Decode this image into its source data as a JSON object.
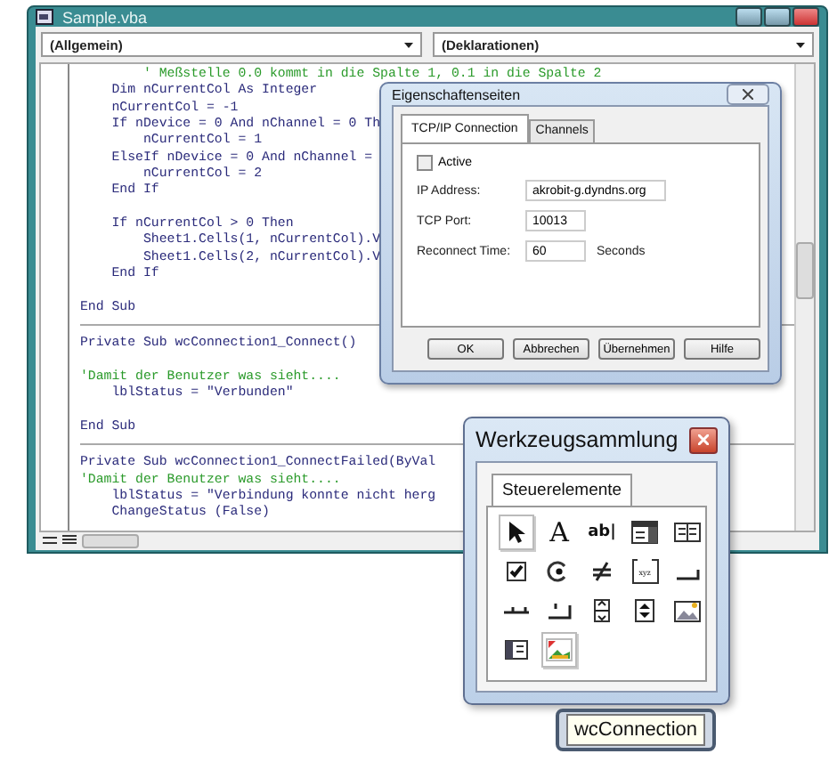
{
  "editor": {
    "title": "Sample.vba",
    "object_dropdown": "(Allgemein)",
    "procedure_dropdown": "(Deklarationen)",
    "procedures": [
      {
        "lines": [
          {
            "kind": "comment",
            "text": "        ' Meßstelle 0.0 kommt in die Spalte 1, 0.1 in die Spalte 2"
          },
          {
            "kind": "code",
            "text": "    Dim nCurrentCol As Integer"
          },
          {
            "kind": "code",
            "text": "    nCurrentCol = -1"
          },
          {
            "kind": "code",
            "text": "    If nDevice = 0 And nChannel = 0 Th"
          },
          {
            "kind": "code",
            "text": "        nCurrentCol = 1"
          },
          {
            "kind": "code",
            "text": "    ElseIf nDevice = 0 And nChannel ="
          },
          {
            "kind": "code",
            "text": "        nCurrentCol = 2"
          },
          {
            "kind": "code",
            "text": "    End If"
          },
          {
            "kind": "blank"
          },
          {
            "kind": "code",
            "text": "    If nCurrentCol > 0 Then"
          },
          {
            "kind": "code",
            "text": "        Sheet1.Cells(1, nCurrentCol).V"
          },
          {
            "kind": "code",
            "text": "        Sheet1.Cells(2, nCurrentCol).V"
          },
          {
            "kind": "code",
            "text": "    End If"
          },
          {
            "kind": "blank"
          },
          {
            "kind": "code",
            "text": "End Sub"
          }
        ]
      },
      {
        "lines": [
          {
            "kind": "code",
            "text": "Private Sub wcConnection1_Connect()"
          },
          {
            "kind": "blank"
          },
          {
            "kind": "comment",
            "text": "'Damit der Benutzer was sieht...."
          },
          {
            "kind": "code",
            "text": "    lblStatus = \"Verbunden\""
          },
          {
            "kind": "blank"
          },
          {
            "kind": "code",
            "text": "End Sub"
          }
        ]
      },
      {
        "lines": [
          {
            "kind": "code",
            "text": "Private Sub wcConnection1_ConnectFailed(ByVal"
          },
          {
            "kind": "comment",
            "text": "'Damit der Benutzer was sieht...."
          },
          {
            "kind": "code",
            "text": "    lblStatus = \"Verbindung konnte nicht herg"
          },
          {
            "kind": "code",
            "text": "    ChangeStatus (False)"
          }
        ]
      }
    ]
  },
  "dialog": {
    "title": "Eigenschaftenseiten",
    "tabs": [
      {
        "label": "TCP/IP Connection",
        "selected": true
      },
      {
        "label": "Channels",
        "selected": false
      }
    ],
    "active": {
      "label": "Active",
      "checked": false
    },
    "fields": [
      {
        "label": "IP Address:",
        "value": "akrobit-g.dyndns.org",
        "wide": true
      },
      {
        "label": "TCP Port:",
        "value": "10013",
        "wide": false
      },
      {
        "label": "Reconnect Time:",
        "value": "60",
        "wide": false,
        "unit": "Seconds"
      }
    ],
    "buttons": [
      "OK",
      "Abbrechen",
      "Übernehmen",
      "Hilfe"
    ]
  },
  "toolbox": {
    "title": "Werkzeugsammlung",
    "tabs": [
      {
        "label": "Steuerelemente",
        "selected": true
      }
    ],
    "tools": [
      {
        "kind": "pointer",
        "selected": true
      },
      {
        "kind": "label",
        "glyph": "A",
        "selected": false
      },
      {
        "kind": "textbox",
        "glyph": "ab|",
        "selected": false
      },
      {
        "kind": "combobox",
        "selected": false
      },
      {
        "kind": "listbox",
        "selected": false
      },
      {
        "kind": "checkbox",
        "selected": false
      },
      {
        "kind": "option",
        "selected": false
      },
      {
        "kind": "toggle",
        "selected": false
      },
      {
        "kind": "frame",
        "glyph": "xyz",
        "selected": false
      },
      {
        "kind": "commandbutton",
        "selected": false
      },
      {
        "kind": "tabstrip",
        "selected": false
      },
      {
        "kind": "multipage",
        "selected": false
      },
      {
        "kind": "scrollbar",
        "selected": false
      },
      {
        "kind": "spin",
        "selected": false
      },
      {
        "kind": "image",
        "selected": false
      },
      {
        "kind": "refedit",
        "selected": false
      },
      {
        "kind": "custom",
        "selected": true
      }
    ]
  },
  "tooltip": {
    "text": "wcConnection"
  }
}
